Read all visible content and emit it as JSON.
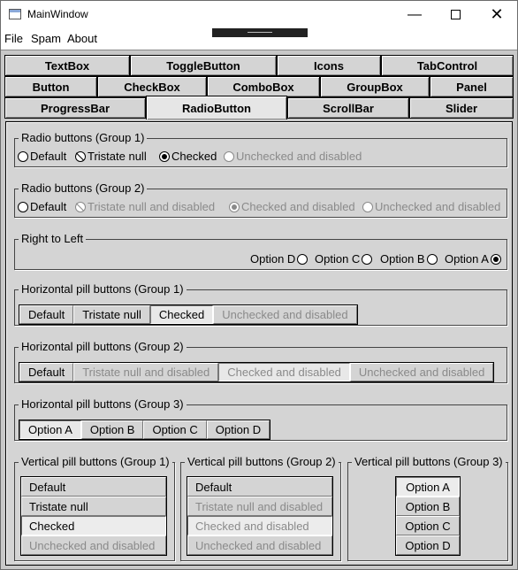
{
  "window": {
    "title": "MainWindow",
    "min_glyph": "—",
    "close_glyph": "✕"
  },
  "menu": [
    "File",
    "Spam",
    "About"
  ],
  "tabs": {
    "row1": [
      "TextBox",
      "ToggleButton",
      "Icons",
      "TabControl"
    ],
    "row2": [
      "Button",
      "CheckBox",
      "ComboBox",
      "GroupBox",
      "Panel"
    ],
    "row3": [
      "ProgressBar",
      "RadioButton",
      "ScrollBar",
      "Slider"
    ],
    "active": "RadioButton"
  },
  "groups": {
    "g1": {
      "title": "Radio buttons (Group 1)",
      "items": [
        "Default",
        "Tristate null",
        "Checked",
        "Unchecked and disabled"
      ]
    },
    "g2": {
      "title": "Radio buttons (Group 2)",
      "items": [
        "Default",
        "Tristate null and disabled",
        "Checked and disabled",
        "Unchecked and disabled"
      ]
    },
    "rtl": {
      "title": "Right to Left",
      "items": [
        "Option D",
        "Option C",
        "Option B",
        "Option A"
      ]
    },
    "hp1": {
      "title": "Horizontal pill buttons (Group 1)",
      "items": [
        "Default",
        "Tristate null",
        "Checked",
        "Unchecked and disabled"
      ]
    },
    "hp2": {
      "title": "Horizontal pill buttons (Group 2)",
      "items": [
        "Default",
        "Tristate null and disabled",
        "Checked and disabled",
        "Unchecked and disabled"
      ]
    },
    "hp3": {
      "title": "Horizontal pill buttons (Group 3)",
      "items": [
        "Option A",
        "Option B",
        "Option C",
        "Option D"
      ]
    },
    "vp1": {
      "title": "Vertical pill buttons (Group 1)",
      "items": [
        "Default",
        "Tristate null",
        "Checked",
        "Unchecked and disabled"
      ]
    },
    "vp2": {
      "title": "Vertical pill buttons (Group 2)",
      "items": [
        "Default",
        "Tristate null and disabled",
        "Checked and disabled",
        "Unchecked and disabled"
      ]
    },
    "vp3": {
      "title": "Vertical pill buttons (Group 3)",
      "items": [
        "Option A",
        "Option B",
        "Option C",
        "Option D"
      ]
    }
  }
}
